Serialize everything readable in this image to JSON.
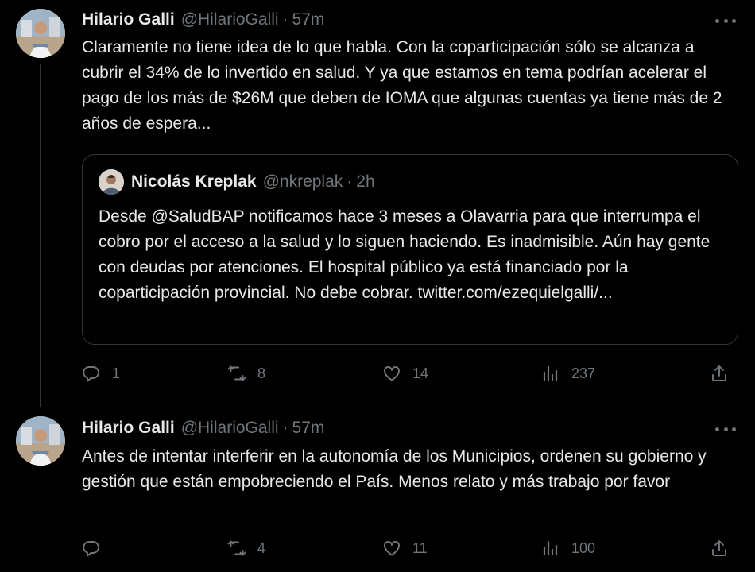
{
  "tweets": [
    {
      "author": {
        "name": "Hilario Galli",
        "handle": "@HilarioGalli",
        "time": "57m"
      },
      "text": "Claramente no tiene idea de lo que habla. Con la coparticipación sólo se alcanza a cubrir el 34% de lo invertido en salud. Y ya que estamos en tema podrían acelerar el pago de los más de $26M que deben de IOMA que algunas cuentas ya tiene más de 2 años de espera...",
      "quote": {
        "author": {
          "name": "Nicolás Kreplak",
          "handle": "@nkreplak",
          "time": "2h"
        },
        "text": "Desde @SaludBAP notificamos hace 3 meses a Olavarria para que interrumpa el cobro por el acceso a la salud y lo siguen haciendo. Es inadmisible. Aún hay gente con deudas por atenciones. El hospital público ya está financiado por la coparticipación provincial. No debe cobrar. twitter.com/ezequielgalli/..."
      },
      "actions": {
        "replies": "1",
        "retweets": "8",
        "likes": "14",
        "views": "237"
      }
    },
    {
      "author": {
        "name": "Hilario Galli",
        "handle": "@HilarioGalli",
        "time": "57m"
      },
      "text": "Antes de intentar interferir en la autonomía de los Municipios, ordenen su gobierno y gestión que están empobreciendo el País. Menos relato y más trabajo por favor",
      "actions": {
        "replies": "",
        "retweets": "4",
        "likes": "11",
        "views": "100"
      }
    }
  ],
  "separator": "·",
  "icons": [
    "reply-icon",
    "retweet-icon",
    "like-icon",
    "views-icon",
    "share-icon",
    "more-icon"
  ],
  "colors": {
    "background": "#000000",
    "text": "#e7e9ea",
    "secondary": "#71767b",
    "border": "#333639"
  }
}
